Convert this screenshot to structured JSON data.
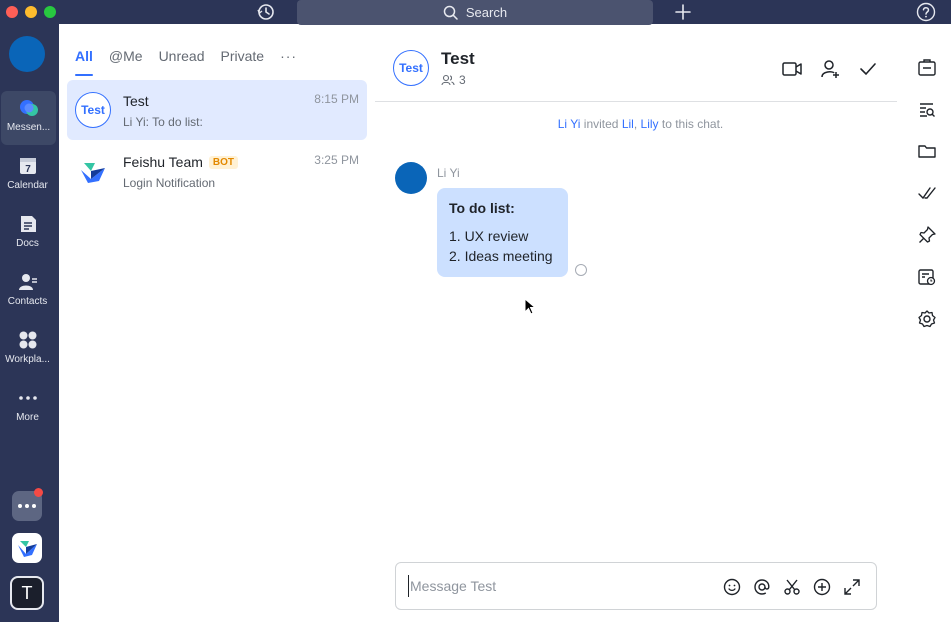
{
  "titlebar": {
    "search_label": "Search"
  },
  "nav": {
    "items": [
      {
        "label": "Messen...",
        "icon": "messenger-icon"
      },
      {
        "label": "Calendar",
        "icon": "calendar-icon",
        "badge": "7"
      },
      {
        "label": "Docs",
        "icon": "docs-icon"
      },
      {
        "label": "Contacts",
        "icon": "contacts-icon"
      },
      {
        "label": "Workpla...",
        "icon": "workplace-icon"
      },
      {
        "label": "More",
        "icon": "more-icon"
      }
    ],
    "app_t_label": "T"
  },
  "chatlist": {
    "tabs": [
      "All",
      "@Me",
      "Unread",
      "Private"
    ],
    "more_label": "···",
    "chats": [
      {
        "avatar_text": "Test",
        "name": "Test",
        "preview": "Li Yi: To do list:",
        "time": "8:15 PM"
      },
      {
        "name": "Feishu Team",
        "badge": "BOT",
        "preview": "Login Notification",
        "time": "3:25 PM"
      }
    ]
  },
  "chat": {
    "avatar_text": "Test",
    "title": "Test",
    "member_count": "3",
    "system": {
      "inviter": "Li Yi",
      "verb": "invited",
      "invitee1": "Lil",
      "sep": ",",
      "invitee2": "Lily",
      "suffix": "to this chat."
    },
    "message": {
      "sender": "Li Yi",
      "title": "To do list:",
      "lines": [
        "1. UX review",
        "2. Ideas meeting"
      ]
    },
    "input_placeholder": "Message Test"
  },
  "colors": {
    "accent": "#3370ff",
    "nav_bg": "#2c3557",
    "bubble": "#cce0ff",
    "selected": "#e1eaff"
  }
}
